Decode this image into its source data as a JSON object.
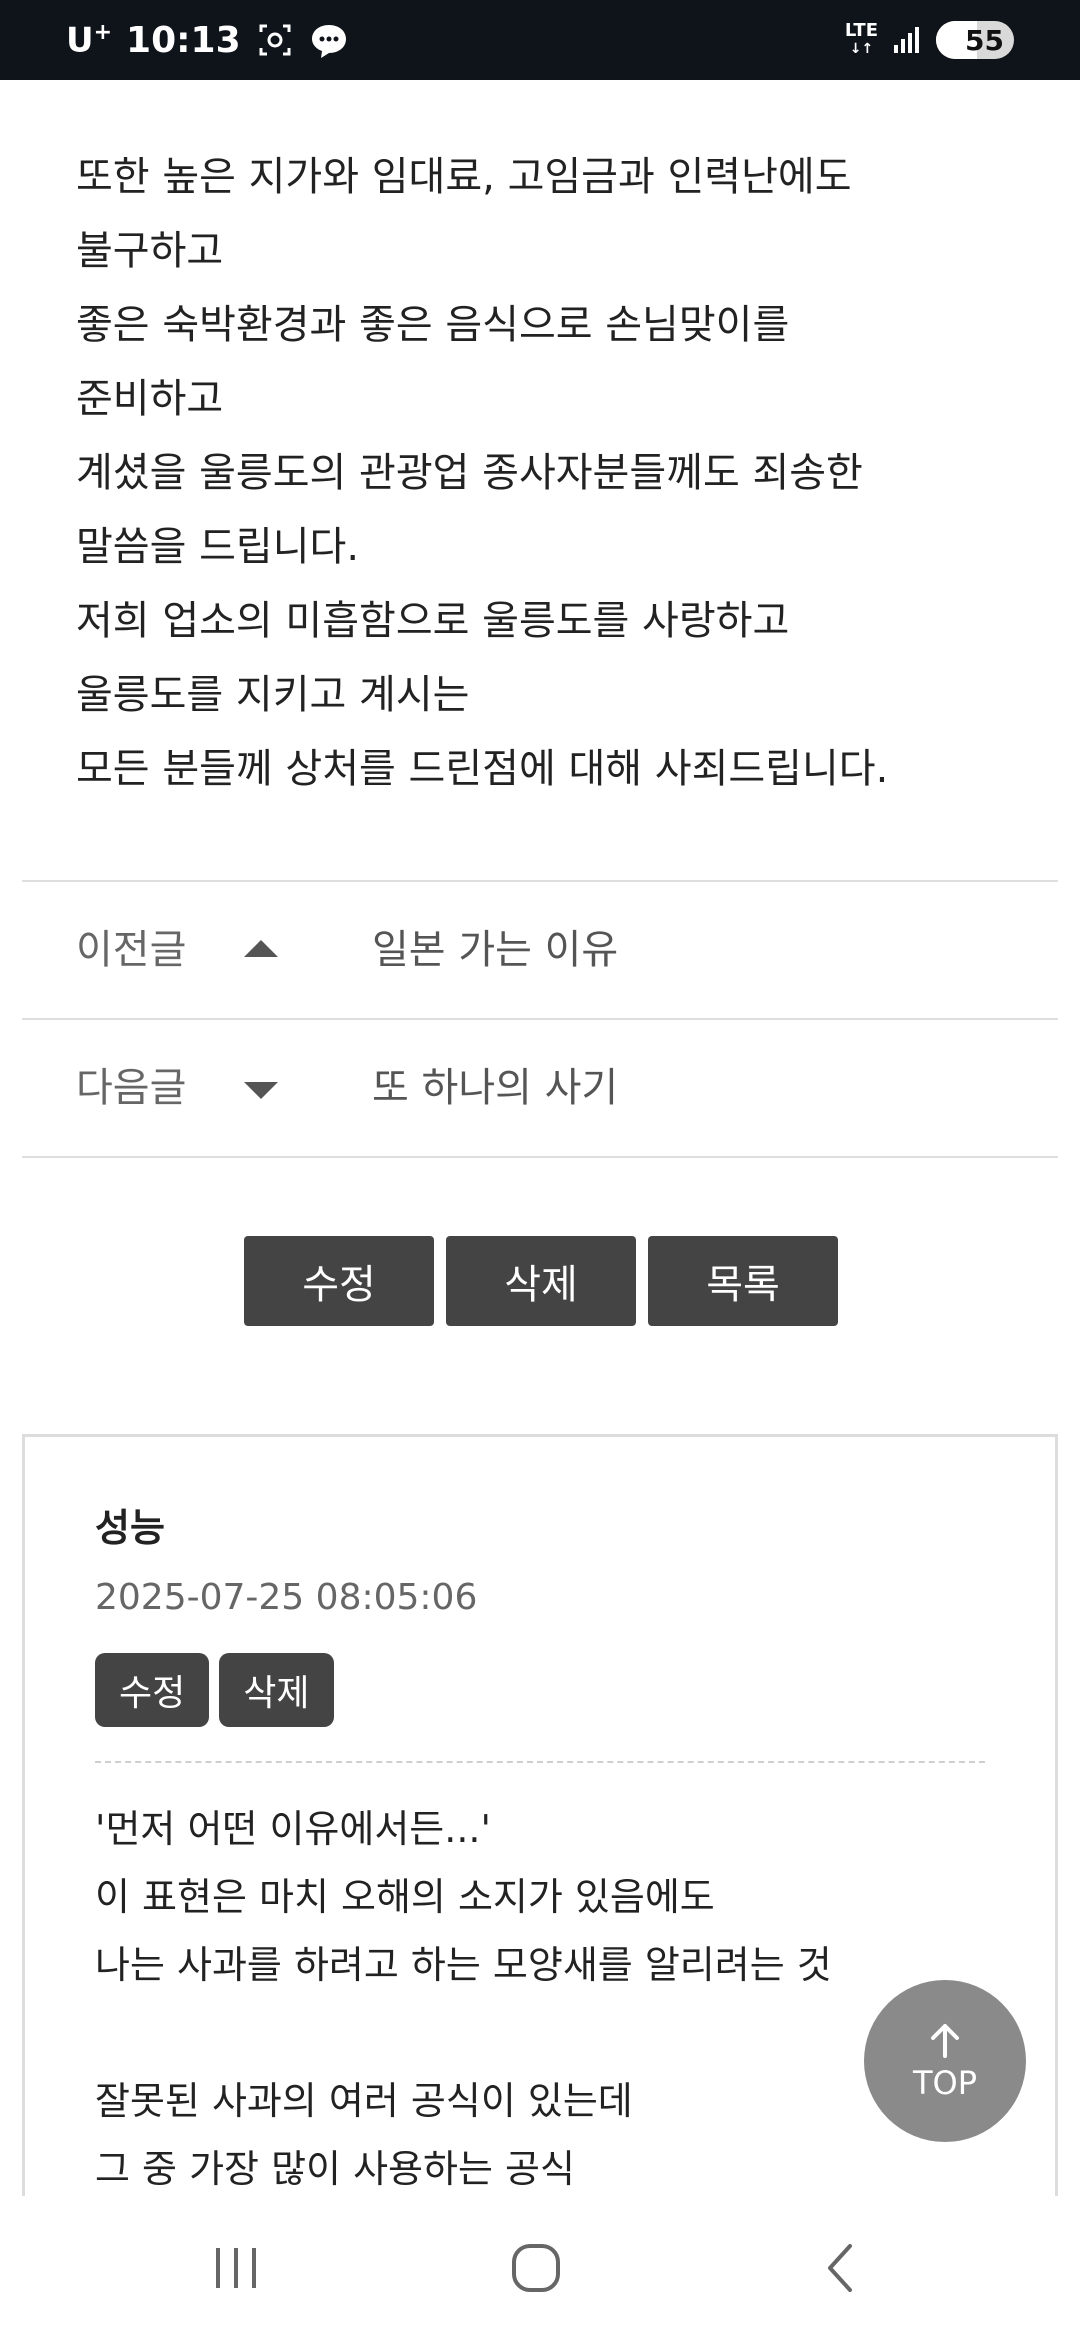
{
  "status_bar": {
    "carrier": "U",
    "carrier_sup": "+",
    "time": "10:13",
    "network": "LTE",
    "battery": "55"
  },
  "article": {
    "lines": [
      "또한 높은 지가와 임대료, 고임금과 인력난에도",
      "불구하고",
      "좋은 숙박환경과 좋은 음식으로 손님맞이를",
      "준비하고",
      "계셨을 울릉도의 관광업 종사자분들께도 죄송한",
      "말씀을 드립니다.",
      "저희 업소의 미흡함으로 울릉도를 사랑하고",
      "울릉도를 지키고 계시는",
      "모든 분들께 상처를 드린점에 대해 사죄드립니다."
    ]
  },
  "post_nav": {
    "prev_label": "이전글",
    "prev_title": "일본 가는 이유",
    "next_label": "다음글",
    "next_title": "또 하나의 사기"
  },
  "post_actions": {
    "edit": "수정",
    "delete": "삭제",
    "list": "목록"
  },
  "comment": {
    "author": "성능",
    "date": "2025-07-25 08:05:06",
    "edit": "수정",
    "delete": "삭제",
    "lines": [
      "'먼저 어떤 이유에서든...'",
      "이 표현은 마치 오해의 소지가 있음에도",
      "나는 사과를 하려고 하는 모양새를 알리려는 것",
      "",
      "잘못된 사과의 여러 공식이 있는데",
      "그 중 가장 많이 사용하는 공식"
    ]
  },
  "top_button": {
    "label": "TOP"
  }
}
